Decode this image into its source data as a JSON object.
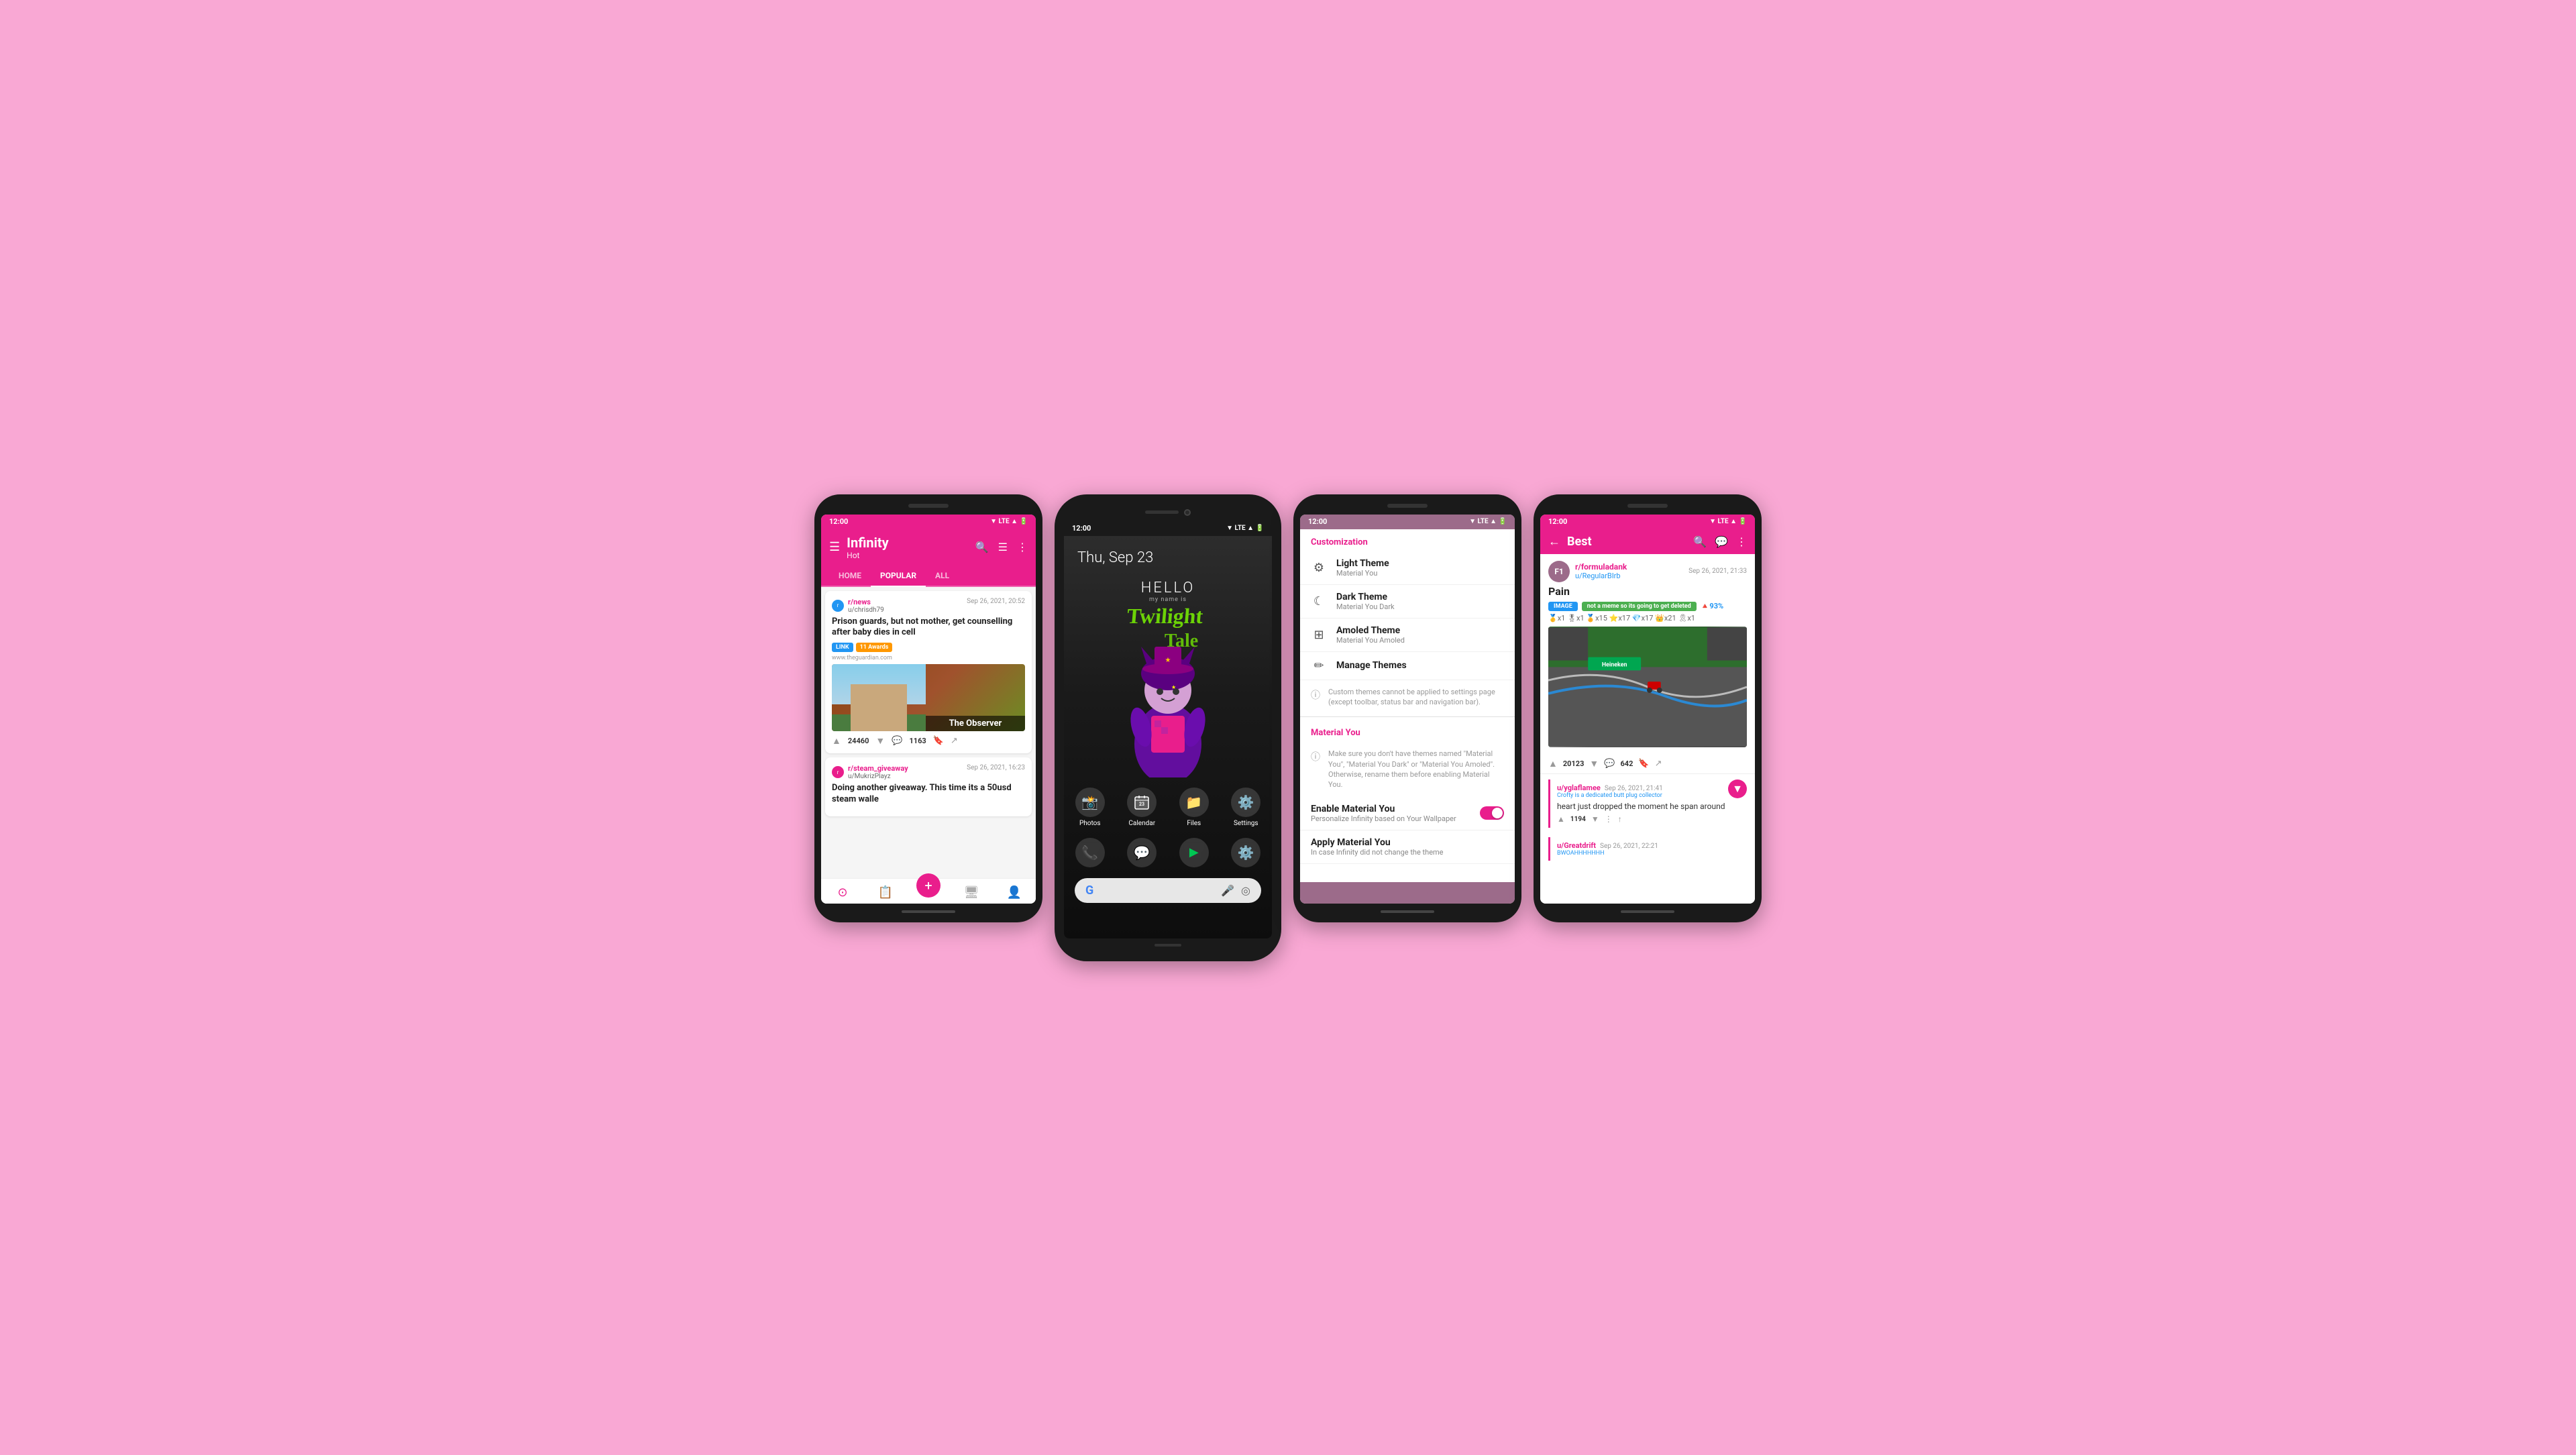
{
  "background_color": "#f9a8d4",
  "screens": [
    {
      "id": "screen1",
      "type": "infinity_hot",
      "status_bar": {
        "time": "12:00",
        "icons": "▼ LTE ▲ 🔋"
      },
      "toolbar": {
        "menu_icon": "☰",
        "title": "Infinity",
        "subtitle": "Hot",
        "search_icon": "🔍",
        "filter_icon": "☰",
        "more_icon": "⋮"
      },
      "tabs": [
        {
          "label": "HOME",
          "active": false
        },
        {
          "label": "POPULAR",
          "active": true
        },
        {
          "label": "ALL",
          "active": false
        }
      ],
      "posts": [
        {
          "subreddit": "r/news",
          "user": "u/chrisdh79",
          "date": "Sep 26, 2021, 20:52",
          "title": "Prison guards, but not mother, get counselling after baby dies in cell",
          "tags": [
            "LINK",
            "11 Awards"
          ],
          "domain": "www.theguardian.com",
          "has_image": true,
          "image_caption": "The Observer",
          "votes": "24460",
          "comments": "1163"
        },
        {
          "subreddit": "r/steam_giveaway",
          "user": "u/MukrizPlayz",
          "date": "Sep 26, 2021, 16:23",
          "title": "Doing another giveaway. This time its a 50usd steam walle",
          "tags": [],
          "domain": "",
          "has_image": false,
          "votes": "",
          "comments": ""
        }
      ],
      "bottom_nav": [
        {
          "icon": "⊙",
          "active": true
        },
        {
          "icon": "📋",
          "active": false
        },
        {
          "icon": "+",
          "is_fab": true
        },
        {
          "icon": "🖥",
          "active": false
        },
        {
          "icon": "👤",
          "active": false
        }
      ]
    },
    {
      "id": "screen2",
      "type": "android_home",
      "status_bar": {
        "time": "12:00",
        "icons": "▼ LTE ▲ 🔋"
      },
      "date_label": "Thu, Sep 23",
      "hello_title": "HELLO",
      "hello_subtitle": "my name is",
      "character_name": "Twilight Tale",
      "app_rows": [
        [
          {
            "icon": "📸",
            "label": "Photos"
          },
          {
            "icon": "📅",
            "label": "Calendar"
          },
          {
            "icon": "📁",
            "label": "Files"
          },
          {
            "icon": "⚙️",
            "label": "Settings"
          }
        ],
        [
          {
            "icon": "📞",
            "label": ""
          },
          {
            "icon": "💬",
            "label": ""
          },
          {
            "icon": "▶",
            "label": ""
          },
          {
            "icon": "⚙️",
            "label": ""
          }
        ]
      ],
      "search_bar": {
        "g_icon": "G",
        "mic_icon": "🎤",
        "lens_icon": "◎"
      }
    },
    {
      "id": "screen3",
      "type": "customization",
      "status_bar": {
        "time": "12:00",
        "icons": "▼ LTE ▲ 🔋"
      },
      "section_customization": "Customization",
      "items": [
        {
          "icon": "⚙",
          "title": "Light Theme",
          "subtitle": "Material You"
        },
        {
          "icon": "☾",
          "title": "Dark Theme",
          "subtitle": "Material You Dark"
        },
        {
          "icon": "⊞",
          "title": "Amoled Theme",
          "subtitle": "Material You Amoled"
        },
        {
          "icon": "✏",
          "title": "Manage Themes",
          "subtitle": ""
        }
      ],
      "info_text": "Custom themes cannot be applied to settings page (except toolbar, status bar and navigation bar).",
      "section_material_you": "Material You",
      "material_you_warning": "Make sure you don't have themes named \"Material You\", \"Material You Dark\" or \"Material You Amoled\". Otherwise, rename them before enabling Material You.",
      "enable_material_you_title": "Enable Material You",
      "enable_material_you_subtitle": "Personalize Infinity based on Your Wallpaper",
      "toggle_on": true,
      "apply_material_you_title": "Apply Material You",
      "apply_material_you_subtitle": "In case Infinity did not change the theme"
    },
    {
      "id": "screen4",
      "type": "best_comments",
      "status_bar": {
        "time": "12:00",
        "icons": "▼ LTE ▲ 🔋"
      },
      "toolbar": {
        "back_icon": "←",
        "title": "Best",
        "search_icon": "🔍",
        "comments_icon": "💬",
        "more_icon": "⋮"
      },
      "post": {
        "subreddit": "r/formuladank",
        "user": "u/RegularBIrb",
        "date": "Sep 26, 2021, 21:33",
        "title": "Pain",
        "badge_image": "IMAGE",
        "badge_meme": "not a meme so its going to get deleted",
        "badge_percent": "🔺93%",
        "awards": "🥇x1 🎖x1 🏅x15 ⭐x17 💎x17 👑x21 🎗x1",
        "votes": "20123",
        "comments": "642"
      },
      "comments": [
        {
          "user": "u/yglaflamee",
          "flair": "Crofty is a dedicated butt plug collector",
          "date": "Sep 26, 2021, 21:41",
          "votes": "1194",
          "text": "heart just dropped the moment he span around"
        },
        {
          "user": "u/Greatdrift",
          "flair": "BWOAHHHHHHH",
          "date": "Sep 26, 2021, 22:21",
          "votes": "",
          "text": ""
        }
      ]
    }
  ]
}
